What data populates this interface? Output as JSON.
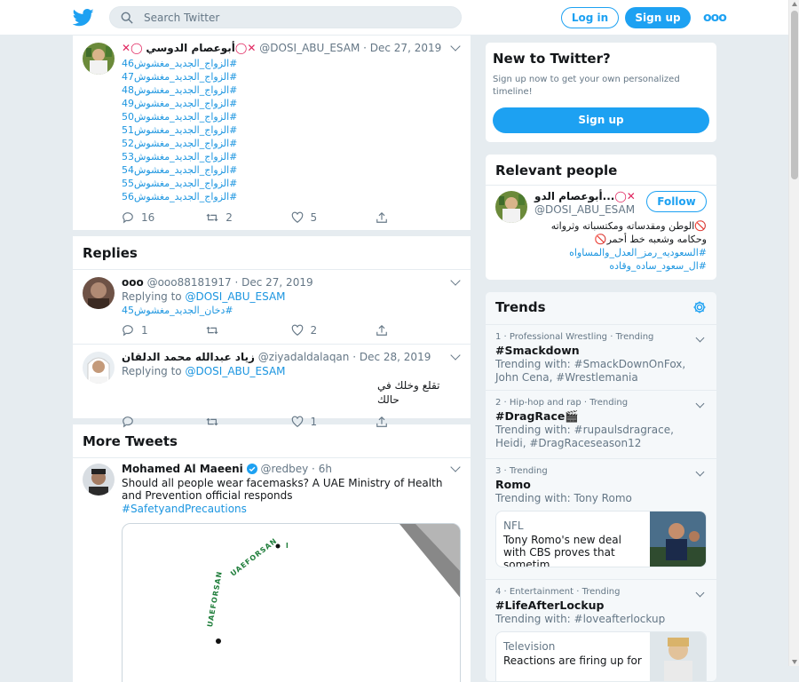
{
  "header": {
    "search_placeholder": "Search Twitter",
    "login": "Log in",
    "signup": "Sign up",
    "more": "ooo"
  },
  "main_tweet": {
    "name": "أبوعصام الدوسي",
    "handle": "@DOSI_ABU_ESAM",
    "date": "Dec 27, 2019",
    "hashtags": [
      "#الزواج_الجديد_مغشوش46",
      "#الزواج_الجديد_مغشوش47",
      "#الزواج_الجديد_مغشوش48",
      "#الزواج_الجديد_مغشوش49",
      "#الزواج_الجديد_مغشوش50",
      "#الزواج_الجديد_مغشوش51",
      "#الزواج_الجديد_مغشوش52",
      "#الزواج_الجديد_مغشوش53",
      "#الزواج_الجديد_مغشوش54",
      "#الزواج_الجديد_مغشوش55",
      "#الزواج_الجديد_مغشوش56"
    ],
    "replies": "16",
    "retweets": "2",
    "likes": "5"
  },
  "replies_section": {
    "title": "Replies",
    "items": [
      {
        "name": "ooo",
        "handle": "@ooo88181917",
        "date": "Dec 27, 2019",
        "replying_label": "Replying to",
        "replying_to": "@DOSI_ABU_ESAM",
        "text": "#دخان_الجديد_مغشوش45",
        "replies": "1",
        "retweets": "",
        "likes": "2"
      },
      {
        "name": "زياد عبدالله محمد الدلقان",
        "handle": "@ziyadaldalaqan",
        "date": "Dec 28, 2019",
        "replying_label": "Replying to",
        "replying_to": "@DOSI_ABU_ESAM",
        "text": "تقلع وخلك في حالك",
        "replies": "",
        "retweets": "",
        "likes": "1"
      }
    ]
  },
  "more_tweets": {
    "title": "More Tweets",
    "tweet": {
      "name": "Mohamed Al Maeeni",
      "handle": "@redbey",
      "time": "6h",
      "text": "Should all people wear facemasks? A UAE Ministry of Health and Prevention official responds",
      "hashtag": "#SafetyandPrecautions",
      "image_text_1": "UAEFORSAN",
      "image_text_2": "UAEFORSAN"
    }
  },
  "new_to_twitter": {
    "title": "New to Twitter?",
    "subtitle": "Sign up now to get your own personalized timeline!",
    "button": "Sign up"
  },
  "relevant_people": {
    "title": "Relevant people",
    "name": "أبوعصام الدو...",
    "handle": "@DOSI_ABU_ESAM",
    "follow": "Follow",
    "bio_line_1": "الوطن ومقدساته ومكتسباته وثرواته",
    "bio_line_2": "وحكامه وشعبه خط أحمر",
    "bio_tag_1": "#السعوديه_رمز_العدل_والمساواه",
    "bio_tag_2": "#ال_سعود_ساده_وقاده"
  },
  "trends": {
    "title": "Trends",
    "items": [
      {
        "meta": "1 · Professional Wrestling · Trending",
        "name": "#Smackdown",
        "with": "Trending with: #SmackDownOnFox, John Cena, #Wrestlemania"
      },
      {
        "meta": "2 · Hip-hop and rap · Trending",
        "name": "#DragRace",
        "with": "Trending with: #rupaulsdragrace, Heidi, #DragRaceseason12"
      },
      {
        "meta": "3 · Trending",
        "name": "Romo",
        "with": "Trending with: Tony Romo",
        "news_cat": "NFL",
        "news_text": "Tony Romo's new deal with CBS proves that sometim..."
      },
      {
        "meta": "4 · Entertainment · Trending",
        "name": "#LifeAfterLockup",
        "with": "Trending with: #loveafterlockup",
        "news_cat": "Television",
        "news_text": "Reactions are firing up for"
      }
    ]
  },
  "colors": {
    "accent": "#1da1f2",
    "link": "#1b95e0",
    "background": "#e6ecf0"
  }
}
